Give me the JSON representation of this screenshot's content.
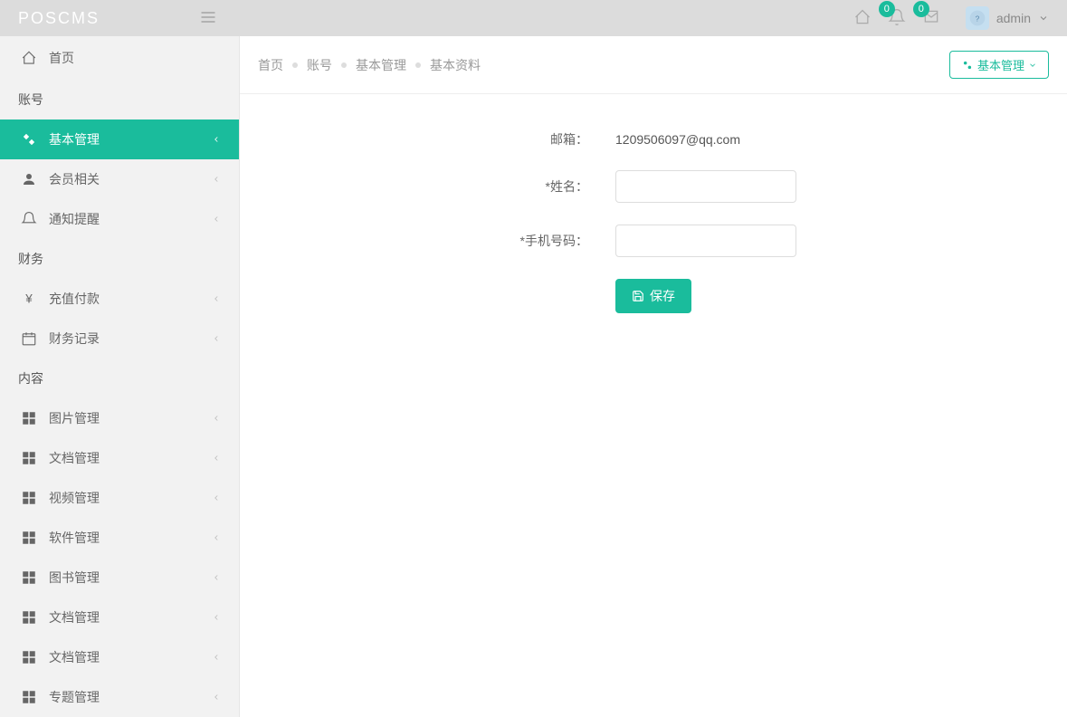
{
  "header": {
    "logo": "POSCMS",
    "notification_badge": "0",
    "message_badge": "0",
    "username": "admin"
  },
  "sidebar": {
    "home_label": "首页",
    "sections": {
      "account": "账号",
      "finance": "财务",
      "content": "内容"
    },
    "items": {
      "basic_mgmt": "基本管理",
      "member_related": "会员相关",
      "notification": "通知提醒",
      "recharge": "充值付款",
      "finance_record": "财务记录",
      "image_mgmt": "图片管理",
      "doc_mgmt1": "文档管理",
      "video_mgmt": "视频管理",
      "software_mgmt": "软件管理",
      "book_mgmt": "图书管理",
      "doc_mgmt2": "文档管理",
      "doc_mgmt3": "文档管理",
      "topic_mgmt": "专题管理"
    }
  },
  "breadcrumb": {
    "home": "首页",
    "account": "账号",
    "basic_mgmt": "基本管理",
    "basic_info": "基本资料"
  },
  "action_button": "基本管理",
  "form": {
    "email_label": "邮箱：",
    "email_value": "1209506097@qq.com",
    "name_label": "*姓名：",
    "name_value": "",
    "phone_label": "*手机号码：",
    "phone_value": "",
    "save_label": "保存"
  }
}
